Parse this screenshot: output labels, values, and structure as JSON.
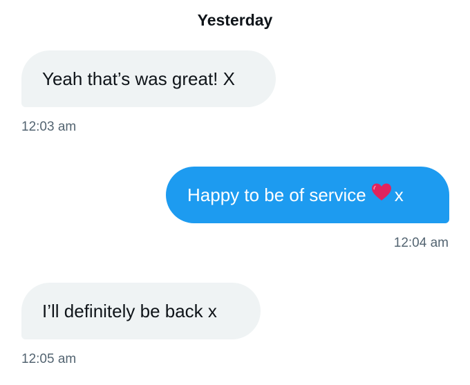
{
  "date_divider": "Yesterday",
  "messages": [
    {
      "direction": "incoming",
      "text": "Yeah that’s was great! X",
      "time": "12:03 am"
    },
    {
      "direction": "outgoing",
      "text_before": "Happy to be of service",
      "emoji": "red-heart-icon",
      "text_after": "x",
      "time": "12:04 am"
    },
    {
      "direction": "incoming",
      "text": "I’ll definitely be back x",
      "time": "12:05 am"
    }
  ],
  "colors": {
    "outgoing_bubble": "#1d9bf0",
    "incoming_bubble": "#eff3f4",
    "timestamp": "#536471",
    "text": "#0f1419",
    "heart": "#e0245e"
  }
}
